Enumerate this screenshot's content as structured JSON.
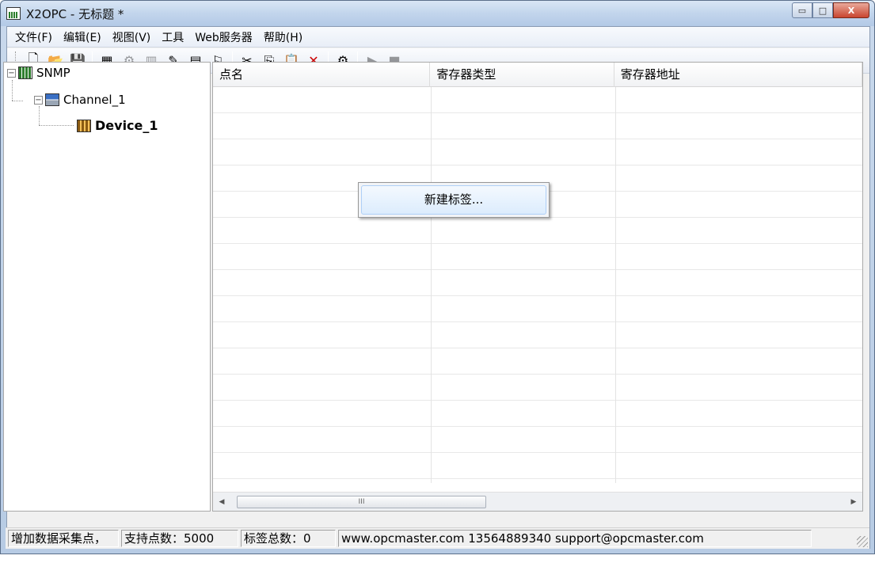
{
  "window": {
    "title": "X2OPC - 无标题 *"
  },
  "caption_buttons": {
    "minimize": "▭",
    "maximize": "□",
    "close": "X"
  },
  "menu": [
    "文件(F)",
    "编辑(E)",
    "视图(V)",
    "工具",
    "Web服务器",
    "帮助(H)"
  ],
  "toolbar": {
    "buttons": [
      {
        "name": "new-file-icon",
        "glyph": "🗋",
        "enabled": true
      },
      {
        "name": "open-folder-icon",
        "glyph": "📂",
        "enabled": true
      },
      {
        "name": "save-icon",
        "glyph": "💾",
        "enabled": true
      },
      {
        "name": "new-channel-icon",
        "glyph": "▦",
        "enabled": true
      },
      {
        "name": "new-device-icon",
        "glyph": "⚙",
        "enabled": false
      },
      {
        "name": "new-group-icon",
        "glyph": "▥",
        "enabled": false
      },
      {
        "name": "new-tag-icon",
        "glyph": "✎",
        "enabled": true
      },
      {
        "name": "multi-tag-icon",
        "glyph": "▤",
        "enabled": true
      },
      {
        "name": "properties-icon",
        "glyph": "⚐",
        "enabled": true
      },
      {
        "name": "cut-icon",
        "glyph": "✂",
        "enabled": true
      },
      {
        "name": "copy-icon",
        "glyph": "⎘",
        "enabled": true
      },
      {
        "name": "paste-icon",
        "glyph": "📋",
        "enabled": true
      },
      {
        "name": "delete-icon",
        "glyph": "✕",
        "enabled": true
      },
      {
        "name": "run-settings-icon",
        "glyph": "⚙",
        "enabled": true
      },
      {
        "name": "start-icon",
        "glyph": "▶",
        "enabled": false
      },
      {
        "name": "stop-icon",
        "glyph": "■",
        "enabled": false
      }
    ]
  },
  "tree": {
    "root": "SNMP",
    "channel": "Channel_1",
    "device": "Device_1"
  },
  "list": {
    "columns": [
      "点名",
      "寄存器类型",
      "寄存器地址"
    ],
    "rows": []
  },
  "scrollbar": {
    "thumb_glyph": "III",
    "left_arrow": "◀",
    "right_arrow": "▶"
  },
  "context_menu": {
    "items": [
      "新建标签..."
    ]
  },
  "status": {
    "hint": "增加数据采集点，",
    "supported_points": "支持点数：5000",
    "tag_total": "标签总数：0",
    "contact": "www.opcmaster.com 13564889340 support@opcmaster.com"
  },
  "colors": {
    "tree_device_bold": "#000000",
    "selection_border": "#aecff7"
  }
}
